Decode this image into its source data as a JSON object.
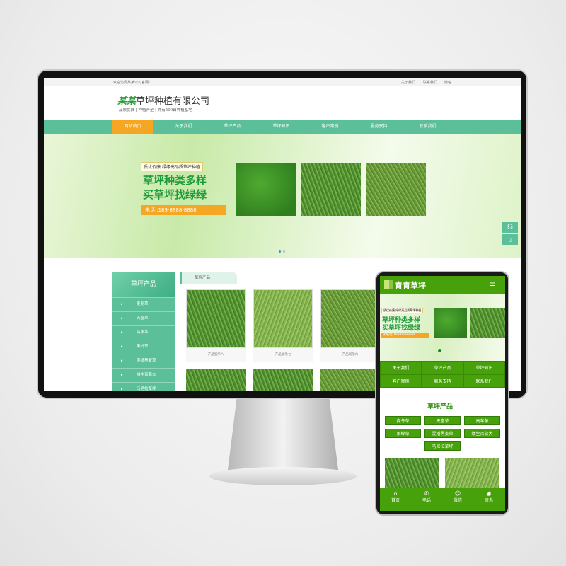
{
  "desktop": {
    "topbar": {
      "welcome": "欢迎访问某某公司官网!",
      "links": [
        "关于我们",
        "联系我们",
        "微信"
      ]
    },
    "logo": {
      "brand": "某某",
      "name": "草坪种植有限公司",
      "tagline": "品质优良 | 种植齐全 | 拥有500亩种植基地"
    },
    "nav": [
      "网站首页",
      "关于我们",
      "草坪产品",
      "草坪知识",
      "客户案例",
      "服务支持",
      "联系我们"
    ],
    "nav_active": 0,
    "banner": {
      "badge": "质优价廉  绿缘高品质草坪种植",
      "line1": "草坪种类多样",
      "line2": "买草坪找绿绿",
      "phone": "电话 :189-8888-8888"
    },
    "float_icons": [
      "headset-icon",
      "phone-icon"
    ],
    "sidebar": {
      "title": "草坪产品",
      "items": [
        "麦冬草",
        "天堂草",
        "高羊茅",
        "果岭草",
        "混播黑麦草",
        "矮生百慕大",
        "马尼拉草坪"
      ]
    },
    "tab": "草坪产品",
    "products": [
      "产品展示八",
      "产品展示七",
      "产品展示六"
    ],
    "colors": {
      "nav": "#5bbf9a",
      "active": "#f5a623"
    }
  },
  "mobile": {
    "logo": "青青草坪",
    "banner": {
      "badge": "质优价廉  绿缘高品质草坪种植",
      "line1": "草坪种类多样",
      "line2": "买草坪找绿绿",
      "phone": "李经理 18988888888"
    },
    "nav": [
      "关于我们",
      "草坪产品",
      "草坪知识",
      "客户案例",
      "服务支持",
      "联系我们"
    ],
    "section_title": "草坪产品",
    "categories": [
      "麦冬草",
      "天堂草",
      "高羊茅",
      "果岭草",
      "混播黑麦草",
      "矮生百慕大",
      "马尼拉草坪"
    ],
    "bottom": [
      "首页",
      "电话",
      "微信",
      "联系"
    ],
    "colors": {
      "primary": "#46a10a"
    }
  }
}
